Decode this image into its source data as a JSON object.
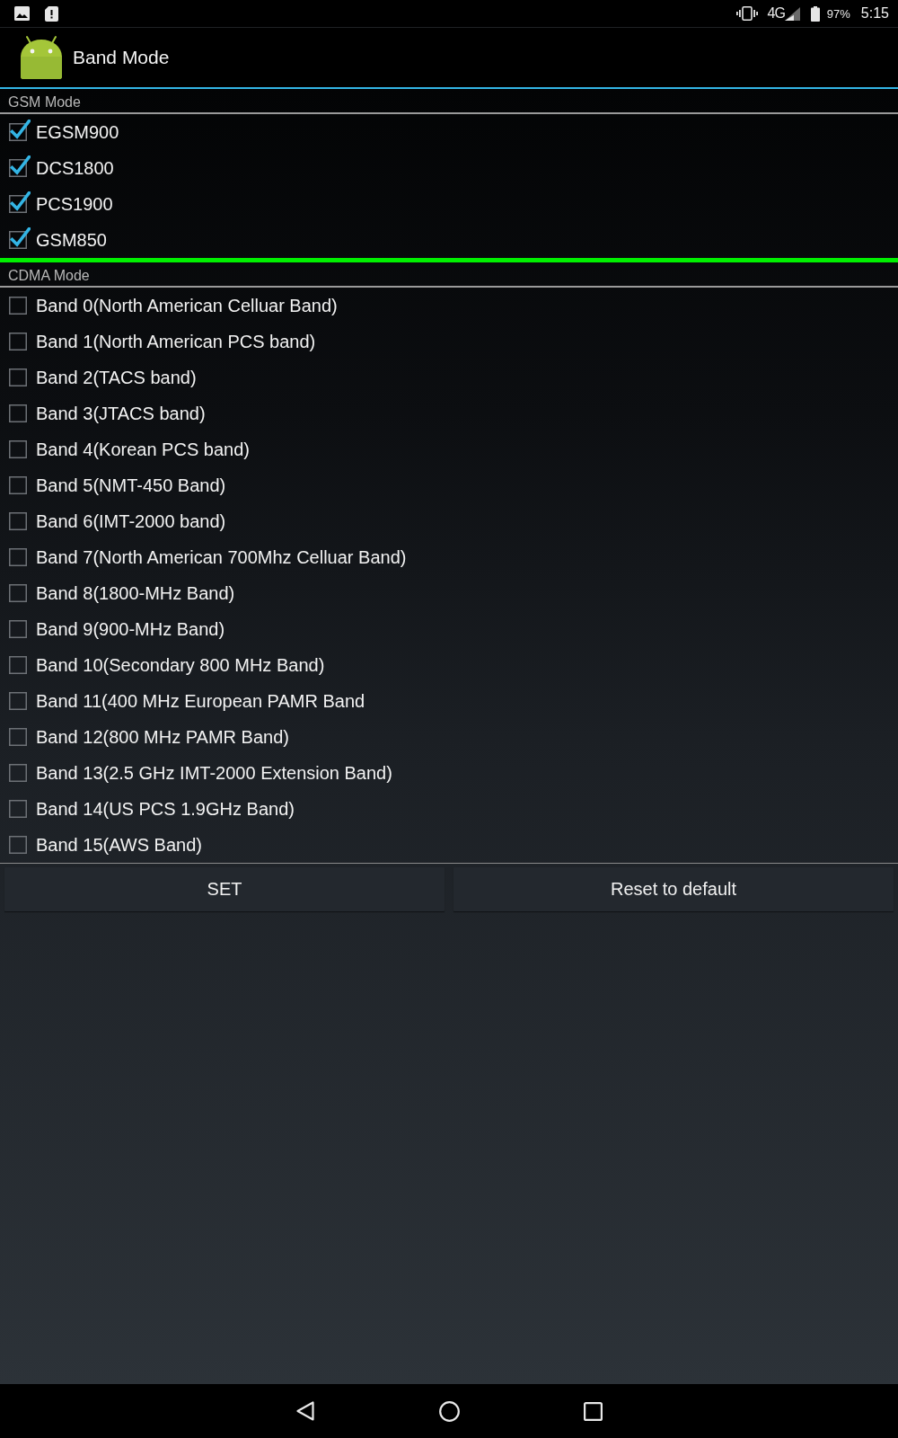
{
  "status_bar": {
    "network": "4G",
    "battery": "97%",
    "time": "5:15"
  },
  "action_bar": {
    "title": "Band Mode"
  },
  "sections": [
    {
      "title": "GSM Mode",
      "items": [
        {
          "label": "EGSM900",
          "checked": true
        },
        {
          "label": "DCS1800",
          "checked": true
        },
        {
          "label": "PCS1900",
          "checked": true
        },
        {
          "label": "GSM850",
          "checked": true
        }
      ]
    },
    {
      "title": "CDMA Mode",
      "items": [
        {
          "label": "Band 0(North American Celluar Band)",
          "checked": false
        },
        {
          "label": "Band 1(North American PCS band)",
          "checked": false
        },
        {
          "label": "Band 2(TACS band)",
          "checked": false
        },
        {
          "label": "Band 3(JTACS band)",
          "checked": false
        },
        {
          "label": "Band 4(Korean PCS band)",
          "checked": false
        },
        {
          "label": "Band 5(NMT-450 Band)",
          "checked": false
        },
        {
          "label": "Band 6(IMT-2000 band)",
          "checked": false
        },
        {
          "label": "Band 7(North American 700Mhz Celluar Band)",
          "checked": false
        },
        {
          "label": "Band 8(1800-MHz Band)",
          "checked": false
        },
        {
          "label": "Band 9(900-MHz Band)",
          "checked": false
        },
        {
          "label": "Band 10(Secondary 800 MHz Band)",
          "checked": false
        },
        {
          "label": "Band 11(400 MHz European PAMR Band",
          "checked": false
        },
        {
          "label": "Band 12(800 MHz PAMR Band)",
          "checked": false
        },
        {
          "label": "Band 13(2.5 GHz IMT-2000 Extension Band)",
          "checked": false
        },
        {
          "label": "Band 14(US PCS 1.9GHz Band)",
          "checked": false
        },
        {
          "label": "Band 15(AWS Band)",
          "checked": false
        }
      ]
    }
  ],
  "buttons": [
    {
      "label": "SET"
    },
    {
      "label": "Reset to default"
    }
  ]
}
